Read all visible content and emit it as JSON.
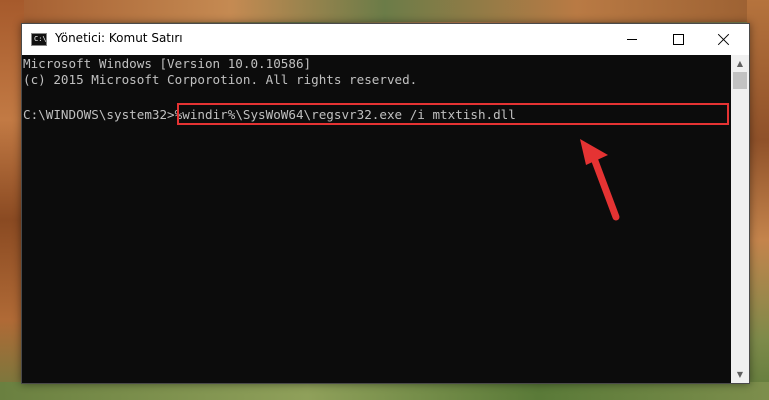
{
  "window": {
    "title": "Yönetici: Komut Satırı",
    "icon": "cmd-icon",
    "controls": {
      "minimize": "minimize-icon",
      "maximize": "maximize-icon",
      "close": "close-icon"
    }
  },
  "console": {
    "line1": "Microsoft Windows [Version 10.0.10586]",
    "line2": "(c) 2015 Microsoft Corporotion. All rights reserved.",
    "prompt": "C:\\WINDOWS\\system32>",
    "command": "%windir%\\SysWoW64\\regsvr32.exe /i mtxtish.dll"
  },
  "colors": {
    "console_bg": "#0c0c0c",
    "console_text": "#c0c0c0",
    "highlight": "#e53333",
    "arrow": "#e53333"
  },
  "annotation": {
    "arrow_icon": "red-arrow-icon"
  }
}
